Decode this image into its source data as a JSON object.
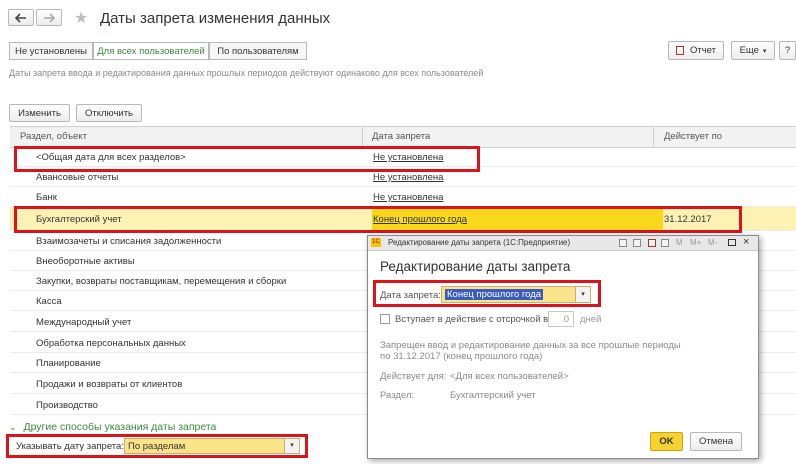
{
  "header": {
    "title": "Даты запрета изменения данных",
    "back_icon": "arrow-left-icon",
    "forward_icon": "arrow-right-icon",
    "favorite_icon": "star-icon"
  },
  "top_buttons": {
    "report_label": "Отчет",
    "more_label": "Еще",
    "help_label": "?"
  },
  "mode_tabs": [
    {
      "label": "Не установлены",
      "active": false
    },
    {
      "label": "Для всех пользователей",
      "active": true
    },
    {
      "label": "По пользователям",
      "active": false
    }
  ],
  "info_text": "Даты запрета ввода и редактирования данных прошлых периодов действуют одинаково для всех пользователей",
  "toolbar": {
    "edit_label": "Изменить",
    "disable_label": "Отключить"
  },
  "table": {
    "columns": [
      "Раздел, объект",
      "Дата запрета",
      "Действует по"
    ],
    "rows": [
      {
        "section": "<Общая дата для всех разделов>",
        "date": "Не установлена",
        "until": "",
        "selected": false
      },
      {
        "section": "Авансовые отчеты",
        "date": "Не установлена",
        "until": "",
        "selected": false
      },
      {
        "section": "Банк",
        "date": "Не установлена",
        "until": "",
        "selected": false
      },
      {
        "section": "Бухгалтерский учет",
        "date": "Конец прошлого года",
        "until": "31.12.2017",
        "selected": true
      },
      {
        "section": "Взаимозачеты и списания задолженности",
        "date": "",
        "until": "",
        "selected": false
      },
      {
        "section": "Внеоборотные активы",
        "date": "",
        "until": "",
        "selected": false
      },
      {
        "section": "Закупки, возвраты поставщикам, перемещения и сборки",
        "date": "",
        "until": "",
        "selected": false
      },
      {
        "section": "Касса",
        "date": "",
        "until": "",
        "selected": false
      },
      {
        "section": "Международный учет",
        "date": "",
        "until": "",
        "selected": false
      },
      {
        "section": "Обработка персональных данных",
        "date": "",
        "until": "",
        "selected": false
      },
      {
        "section": "Планирование",
        "date": "",
        "until": "",
        "selected": false
      },
      {
        "section": "Продажи и возвраты от клиентов",
        "date": "",
        "until": "",
        "selected": false
      },
      {
        "section": "Производство",
        "date": "",
        "until": "",
        "selected": false
      }
    ]
  },
  "other_ways": {
    "link_label": "Другие способы указания даты запрета",
    "field_label": "Указывать дату запрета:",
    "field_value": "По разделам"
  },
  "dialog": {
    "window_title": "Редактирование даты запрета (1С:Предприятие)",
    "heading": "Редактирование даты запрета",
    "date_label": "Дата запрета:",
    "date_value": "Конец прошлого года",
    "delay_label": "Вступает в действие с отсрочкой в",
    "delay_value": "0",
    "delay_unit": "дней",
    "note": "Запрещен ввод и редактирование данных за все прошлые периоды по 31.12.2017 (конец прошлого года)",
    "applies_label": "Действует для:",
    "applies_value": "<Для всех пользователей>",
    "section_label": "Раздел:",
    "section_value": "Бухгалтерский учет",
    "ok_label": "OK",
    "cancel_label": "Отмена"
  },
  "colors": {
    "highlight_red": "#d8141c",
    "selected_row": "#fdf1b3",
    "selected_cell": "#f9d71c",
    "link_green": "#3a8a3a",
    "ok_button": "#f5d22e"
  }
}
